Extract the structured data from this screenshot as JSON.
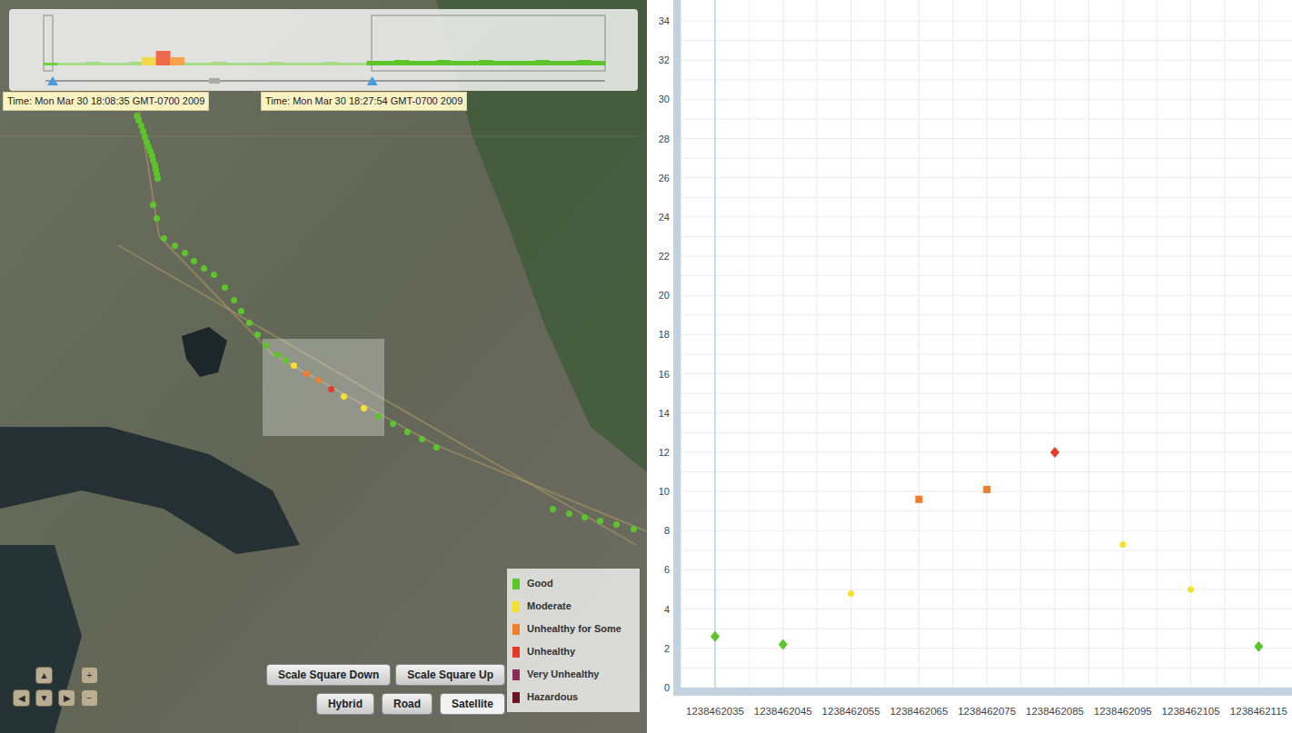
{
  "overview": {
    "samples": [
      {
        "value": 3,
        "color": "#6fd13c"
      },
      {
        "value": 3,
        "color": "#a6dc86"
      },
      {
        "value": 3,
        "color": "#a6dc86"
      },
      {
        "value": 4,
        "color": "#a6dc86"
      },
      {
        "value": 3,
        "color": "#a6dc86"
      },
      {
        "value": 3,
        "color": "#a6dc86"
      },
      {
        "value": 4,
        "color": "#a6dc86"
      },
      {
        "value": 9,
        "color": "#f2d94a"
      },
      {
        "value": 16,
        "color": "#ef6a4a"
      },
      {
        "value": 9,
        "color": "#f5a24a"
      },
      {
        "value": 3,
        "color": "#a6dc86"
      },
      {
        "value": 3,
        "color": "#a6dc86"
      },
      {
        "value": 4,
        "color": "#a6dc86"
      },
      {
        "value": 3,
        "color": "#a6dc86"
      },
      {
        "value": 3,
        "color": "#a6dc86"
      },
      {
        "value": 3,
        "color": "#a6dc86"
      },
      {
        "value": 4,
        "color": "#a6dc86"
      },
      {
        "value": 3,
        "color": "#a6dc86"
      },
      {
        "value": 3,
        "color": "#a6dc86"
      },
      {
        "value": 3,
        "color": "#a6dc86"
      },
      {
        "value": 4,
        "color": "#a6dc86"
      },
      {
        "value": 3,
        "color": "#a6dc86"
      },
      {
        "value": 3,
        "color": "#a6dc86"
      },
      {
        "value": 5,
        "color": "#5cc52a"
      },
      {
        "value": 5,
        "color": "#5cc52a"
      },
      {
        "value": 6,
        "color": "#5cc52a"
      },
      {
        "value": 5,
        "color": "#5cc52a"
      },
      {
        "value": 5,
        "color": "#5cc52a"
      },
      {
        "value": 6,
        "color": "#5cc52a"
      },
      {
        "value": 5,
        "color": "#5cc52a"
      },
      {
        "value": 5,
        "color": "#5cc52a"
      },
      {
        "value": 6,
        "color": "#5cc52a"
      },
      {
        "value": 5,
        "color": "#5cc52a"
      },
      {
        "value": 5,
        "color": "#5cc52a"
      },
      {
        "value": 5,
        "color": "#5cc52a"
      },
      {
        "value": 6,
        "color": "#5cc52a"
      },
      {
        "value": 5,
        "color": "#5cc52a"
      },
      {
        "value": 5,
        "color": "#5cc52a"
      },
      {
        "value": 6,
        "color": "#5cc52a"
      },
      {
        "value": 5,
        "color": "#5cc52a"
      }
    ],
    "range": {
      "start": 0.013,
      "end": 0.584
    },
    "start_label": "Time: Mon Mar 30 18:08:35 GMT-0700 2009",
    "end_label": "Time: Mon Mar 30 18:27:54 GMT-0700 2009"
  },
  "route": {
    "points": [
      {
        "color": "#5cc52a"
      },
      {
        "color": "#5cc52a"
      },
      {
        "color": "#5cc52a"
      },
      {
        "color": "#5cc52a"
      },
      {
        "color": "#5cc52a"
      },
      {
        "color": "#5cc52a"
      },
      {
        "color": "#5cc52a"
      },
      {
        "color": "#5cc52a"
      },
      {
        "color": "#5cc52a"
      },
      {
        "color": "#5cc52a"
      },
      {
        "color": "#5cc52a"
      },
      {
        "color": "#5cc52a"
      },
      {
        "color": "#5cc52a"
      },
      {
        "color": "#5cc52a"
      },
      {
        "color": "#5cc52a"
      },
      {
        "color": "#5cc52a"
      },
      {
        "color": "#5cc52a"
      },
      {
        "color": "#5cc52a"
      },
      {
        "color": "#5cc52a"
      },
      {
        "color": "#5cc52a"
      },
      {
        "color": "#5cc52a"
      },
      {
        "color": "#5cc52a"
      },
      {
        "color": "#5cc52a"
      },
      {
        "color": "#5cc52a"
      },
      {
        "color": "#5cc52a"
      },
      {
        "color": "#5cc52a"
      },
      {
        "color": "#5cc52a"
      },
      {
        "color": "#5cc52a"
      },
      {
        "color": "#5cc52a"
      },
      {
        "color": "#5cc52a"
      },
      {
        "color": "#f5e12a"
      },
      {
        "color": "#f07d2a"
      },
      {
        "color": "#f07d2a"
      },
      {
        "color": "#e8392a"
      },
      {
        "color": "#f5e12a"
      },
      {
        "color": "#f5e12a"
      },
      {
        "color": "#5cc52a"
      },
      {
        "color": "#5cc52a"
      },
      {
        "color": "#5cc52a"
      },
      {
        "color": "#5cc52a"
      },
      {
        "color": "#5cc52a"
      },
      {
        "color": "#5cc52a"
      },
      {
        "color": "#5cc52a"
      },
      {
        "color": "#5cc52a"
      },
      {
        "color": "#5cc52a"
      },
      {
        "color": "#5cc52a"
      },
      {
        "color": "#5cc52a"
      }
    ]
  },
  "legend": [
    {
      "label": "Good",
      "color": "#5cc52a"
    },
    {
      "label": "Moderate",
      "color": "#f5e12a"
    },
    {
      "label": "Unhealthy for Some",
      "color": "#f07d2a"
    },
    {
      "label": "Unhealthy",
      "color": "#e8392a"
    },
    {
      "label": "Very Unhealthy",
      "color": "#8b2a54"
    },
    {
      "label": "Hazardous",
      "color": "#6b1426"
    }
  ],
  "nav": {
    "up": "▲",
    "left": "◀",
    "down": "▼",
    "right": "▶",
    "zoom_in": "+",
    "zoom_out": "−"
  },
  "scale_buttons": [
    "Scale Square Down",
    "Scale Square Up"
  ],
  "map_types": [
    {
      "label": "Hybrid",
      "selected": false
    },
    {
      "label": "Road",
      "selected": false
    },
    {
      "label": "Satellite",
      "selected": true
    }
  ],
  "chart": {
    "y_ticks": [
      "0",
      "2",
      "4",
      "6",
      "8",
      "10",
      "12",
      "14",
      "16",
      "18",
      "20",
      "22",
      "24",
      "26",
      "28",
      "30",
      "32",
      "34"
    ],
    "x_ticks": [
      "1238462035",
      "1238462045",
      "1238462055",
      "1238462065",
      "1238462075",
      "1238462085",
      "1238462095",
      "1238462105",
      "1238462115"
    ],
    "cursor_index": 0,
    "points": [
      {
        "time": 1238462035,
        "value": 2.6,
        "color": "#5cc52a",
        "kind": "diamond"
      },
      {
        "time": 1238462045,
        "value": 2.2,
        "color": "#5cc52a",
        "kind": "diamond"
      },
      {
        "time": 1238462055,
        "value": 4.8,
        "color": "#f5e12a",
        "kind": "circle"
      },
      {
        "time": 1238462065,
        "value": 9.6,
        "color": "#f07d2a",
        "kind": "square"
      },
      {
        "time": 1238462075,
        "value": 10.1,
        "color": "#f07d2a",
        "kind": "square"
      },
      {
        "time": 1238462085,
        "value": 12.0,
        "color": "#e8392a",
        "kind": "diamond"
      },
      {
        "time": 1238462095,
        "value": 7.3,
        "color": "#f5e12a",
        "kind": "circle"
      },
      {
        "time": 1238462105,
        "value": 5.0,
        "color": "#f5e12a",
        "kind": "circle"
      },
      {
        "time": 1238462115,
        "value": 2.1,
        "color": "#5cc52a",
        "kind": "diamond"
      }
    ]
  }
}
